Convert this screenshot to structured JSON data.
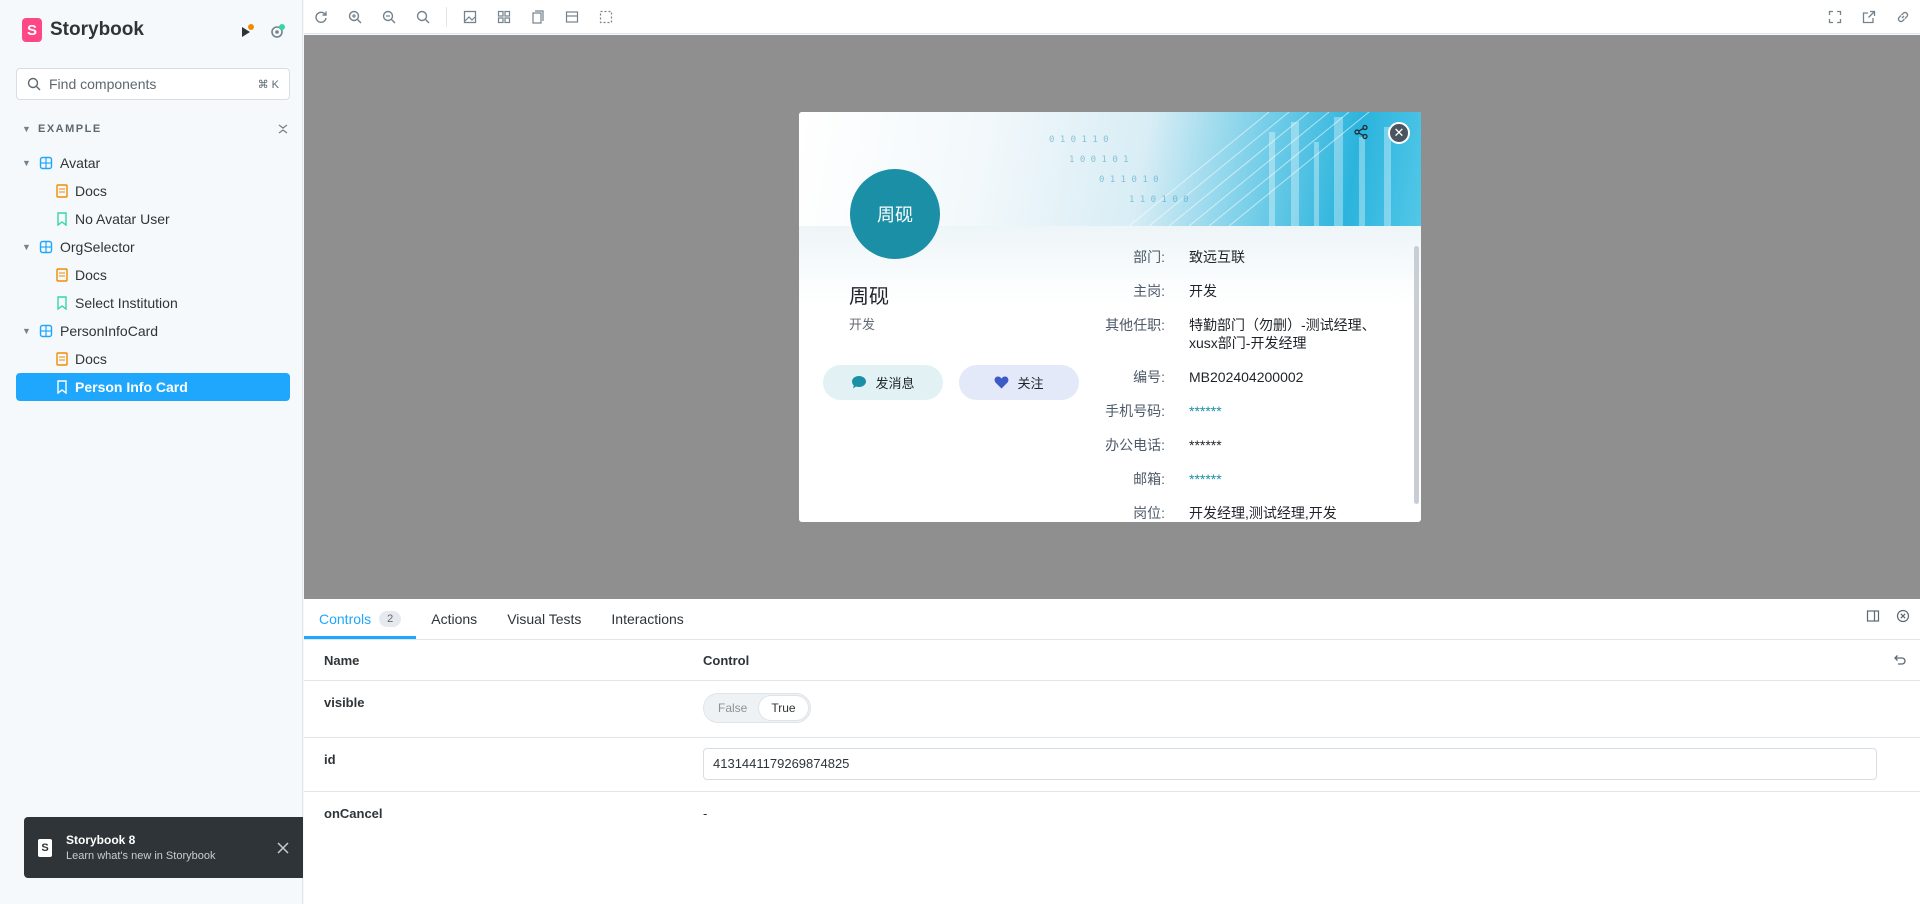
{
  "sidebar": {
    "brand": "Storybook",
    "search_placeholder": "Find components",
    "search_shortcut": "⌘ K",
    "section": "EXAMPLE",
    "tree": [
      {
        "label": "Avatar",
        "level": 1,
        "type": "component"
      },
      {
        "label": "Docs",
        "level": 2,
        "type": "docs"
      },
      {
        "label": "No Avatar User",
        "level": 2,
        "type": "story"
      },
      {
        "label": "OrgSelector",
        "level": 1,
        "type": "component"
      },
      {
        "label": "Docs",
        "level": 2,
        "type": "docs"
      },
      {
        "label": "Select Institution",
        "level": 2,
        "type": "story"
      },
      {
        "label": "PersonInfoCard",
        "level": 1,
        "type": "component"
      },
      {
        "label": "Docs",
        "level": 2,
        "type": "docs"
      },
      {
        "label": "Person Info Card",
        "level": 2,
        "type": "story",
        "active": true
      }
    ]
  },
  "toast": {
    "title": "Storybook 8",
    "subtitle": "Learn what's new in Storybook"
  },
  "card": {
    "avatar_text": "周砚",
    "name": "周砚",
    "role": "开发",
    "message_button": "发消息",
    "follow_button": "关注",
    "info": [
      {
        "label": "部门:",
        "value": "致远互联",
        "masked": false
      },
      {
        "label": "主岗:",
        "value": "开发",
        "masked": false
      },
      {
        "label": "其他任职:",
        "value": "特勤部门（勿删）-测试经理、xusx部门-开发经理",
        "masked": false
      },
      {
        "label": "编号:",
        "value": "MB202404200002",
        "masked": false
      },
      {
        "label": "手机号码:",
        "value": "******",
        "masked": true
      },
      {
        "label": "办公电话:",
        "value": "******",
        "masked": false
      },
      {
        "label": "邮箱:",
        "value": "******",
        "masked": true
      },
      {
        "label": "岗位:",
        "value": "开发经理,测试经理,开发",
        "masked": false
      }
    ]
  },
  "panel": {
    "tabs": [
      {
        "label": "Controls",
        "count": "2",
        "active": true
      },
      {
        "label": "Actions"
      },
      {
        "label": "Visual Tests"
      },
      {
        "label": "Interactions"
      }
    ],
    "columns": {
      "name": "Name",
      "control": "Control"
    },
    "rows": {
      "visible": {
        "name": "visible",
        "false_label": "False",
        "true_label": "True",
        "value": true
      },
      "id": {
        "name": "id",
        "value": "4131441179269874825"
      },
      "oncancel": {
        "name": "onCancel",
        "value": "-"
      }
    }
  },
  "colors": {
    "accent": "#1ea7fd",
    "brand": "#ff4785",
    "card_teal": "#1b8fa6",
    "canvas_bg": "#8f8f8f"
  }
}
